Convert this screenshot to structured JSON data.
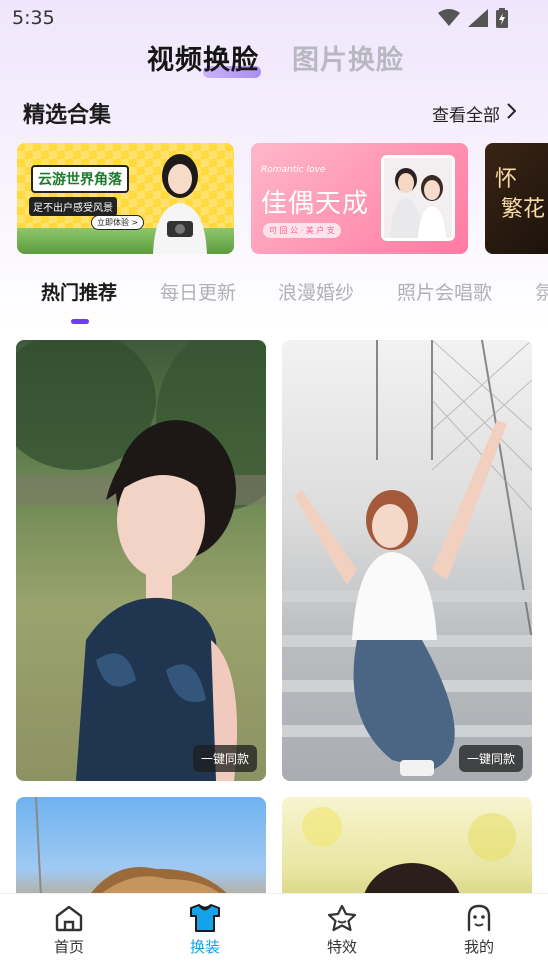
{
  "status_bar": {
    "time": "5:35",
    "icons": [
      "wifi-icon",
      "signal-icon",
      "battery-icon"
    ]
  },
  "header": {
    "tabs": [
      {
        "label": "视频换脸",
        "active": true
      },
      {
        "label": "图片换脸",
        "active": false
      }
    ]
  },
  "featured": {
    "title": "精选合集",
    "more_label": "查看全部",
    "banners": [
      {
        "title": "云游世界角落",
        "subtitle": "足不出户感受风景",
        "button": "立即体验 >"
      },
      {
        "subtitle_en": "Romantic love",
        "title": "佳偶天成",
        "tag": "可 囧 公 · 美 户 支"
      },
      {
        "line1": "怀",
        "line2": "繁花"
      }
    ]
  },
  "categories": [
    {
      "label": "热门推荐",
      "active": true
    },
    {
      "label": "每日更新",
      "active": false
    },
    {
      "label": "浪漫婚纱",
      "active": false
    },
    {
      "label": "照片会唱歌",
      "active": false
    },
    {
      "label": "氛",
      "active": false
    }
  ],
  "cards": [
    {
      "badge": "一键同款"
    },
    {
      "badge": "一键同款"
    }
  ],
  "bottom_nav": [
    {
      "label": "首页",
      "icon": "home-icon",
      "active": false
    },
    {
      "label": "换装",
      "icon": "shirt-icon",
      "active": true
    },
    {
      "label": "特效",
      "icon": "star-icon",
      "active": false
    },
    {
      "label": "我的",
      "icon": "profile-icon",
      "active": false
    }
  ],
  "colors": {
    "accent": "#6b3cf0",
    "nav_active": "#14a2e8"
  }
}
